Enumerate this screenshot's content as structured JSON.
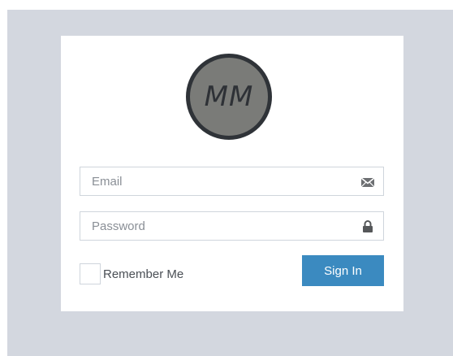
{
  "avatar": {
    "initials": "MM"
  },
  "email": {
    "placeholder": "Email",
    "value": "",
    "icon": "envelope-icon"
  },
  "password": {
    "placeholder": "Password",
    "value": "",
    "icon": "lock-icon"
  },
  "remember": {
    "label": "Remember Me",
    "checked": false
  },
  "signin": {
    "label": "Sign In"
  },
  "colors": {
    "background": "#d3d7df",
    "card": "#ffffff",
    "avatar_fill": "#7a7b78",
    "avatar_border": "#2f3338",
    "button": "#3b8ac0"
  }
}
